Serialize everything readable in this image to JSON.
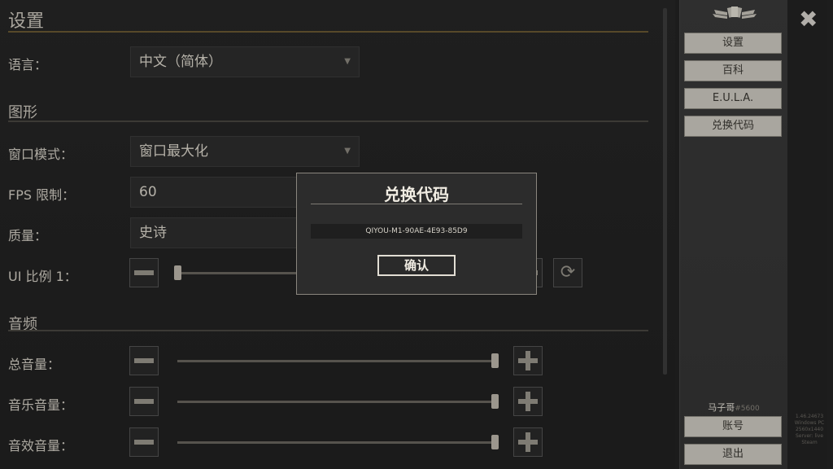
{
  "settings": {
    "title": "设置",
    "language_label": "语言：",
    "language_value": "中文（简体）",
    "graphics_header": "图形",
    "window_mode_label": "窗口模式：",
    "window_mode_value": "窗口最大化",
    "fps_label": "FPS 限制：",
    "fps_value": "60",
    "quality_label": "质量：",
    "quality_value": "史诗",
    "ui_scale_label": "UI 比例 1：",
    "ui_scale_level": 0.0,
    "audio_header": "音频",
    "master_volume_label": "总音量：",
    "master_volume_level": 1.0,
    "music_volume_label": "音乐音量：",
    "music_volume_level": 1.0,
    "sfx_volume_label": "音效音量：",
    "sfx_volume_level": 1.0
  },
  "sidebar": {
    "menu": [
      "设置",
      "百科",
      "E.U.L.A.",
      "兑换代码"
    ],
    "username": "马子哥",
    "user_tag": "#5600",
    "account_label": "账号",
    "logout_label": "退出",
    "version_lines": [
      "1.46.24673",
      "Windows PC",
      "2560x1440",
      "Server: live",
      "Steam"
    ]
  },
  "modal": {
    "title": "兑换代码",
    "code": "QIYOU-M1-90AE-4E93-85D9",
    "confirm_label": "确认"
  },
  "icons": {
    "close": "close-icon",
    "emblem": "winged-cards-emblem-icon",
    "reset": "refresh-icon",
    "dropdown": "chevron-down-icon"
  },
  "colors": {
    "accent_underline": "#6b5a32",
    "button_bg": "#cfcbc2"
  }
}
